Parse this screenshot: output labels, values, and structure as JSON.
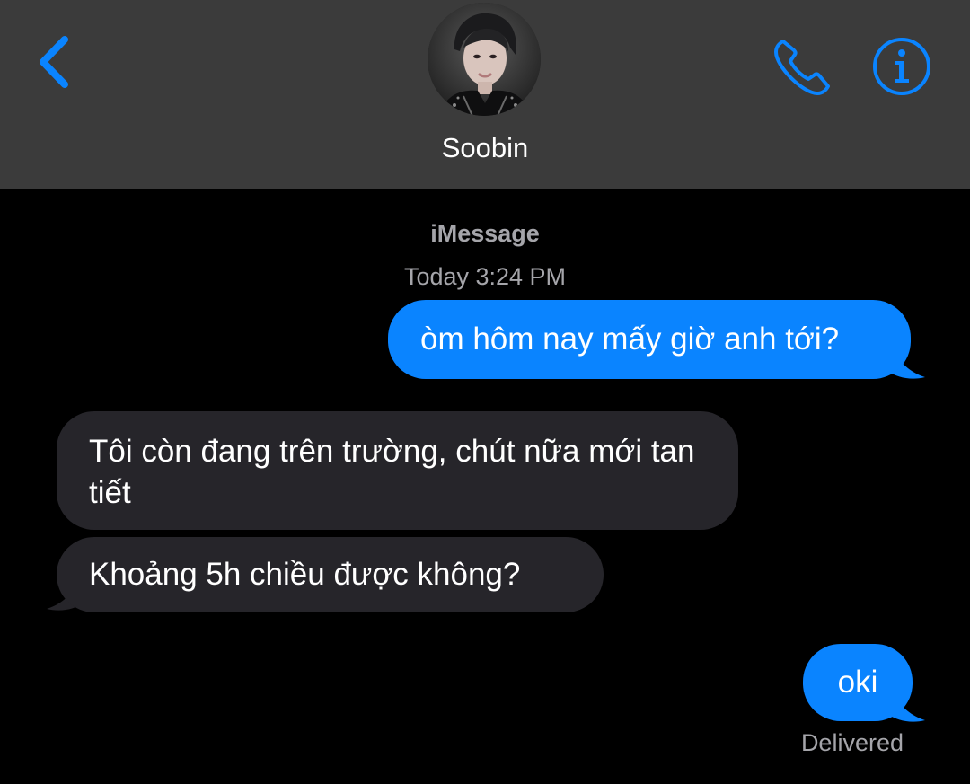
{
  "header": {
    "contact_name": "Soobin",
    "back_icon": "chevron-left-icon",
    "call_icon": "phone-icon",
    "info_icon": "info-icon",
    "accent_color": "#0a84ff"
  },
  "thread": {
    "service": "iMessage",
    "timestamp": "Today 3:24 PM"
  },
  "messages": [
    {
      "direction": "sent",
      "text": "òm hôm nay mấy giờ anh tới?"
    },
    {
      "direction": "received",
      "text": "Tôi còn đang trên trường, chút nữa mới tan tiết"
    },
    {
      "direction": "received",
      "text": "Khoảng 5h chiều được không?"
    },
    {
      "direction": "sent",
      "text": "oki"
    }
  ],
  "status": {
    "delivered": "Delivered"
  },
  "colors": {
    "sent_bubble": "#0a84ff",
    "received_bubble": "#26252a",
    "header_bg": "#3b3b3b",
    "background": "#000000",
    "meta_text": "#a5a5aa"
  }
}
